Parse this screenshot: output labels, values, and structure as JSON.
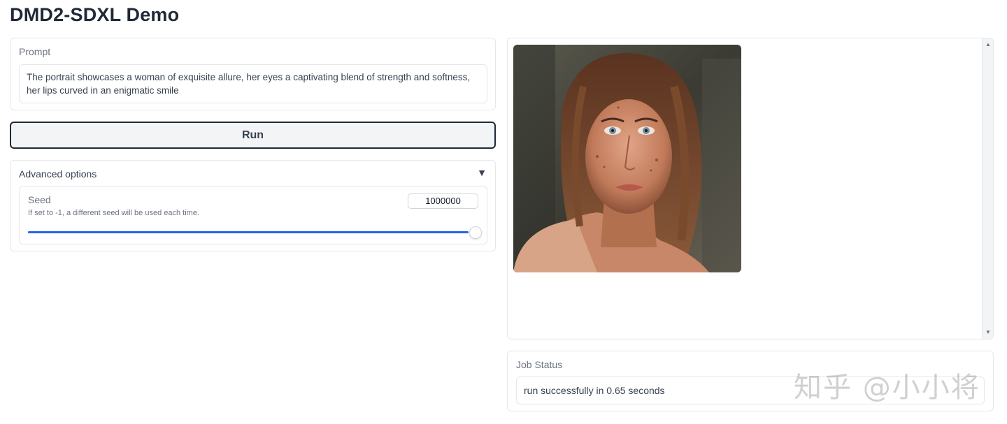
{
  "app": {
    "title": "DMD2-SDXL Demo"
  },
  "prompt": {
    "label": "Prompt",
    "value": "The portrait showcases a woman of exquisite allure, her eyes a captivating blend of strength and softness, her lips curved in an enigmatic smile"
  },
  "run_button": {
    "label": "Run"
  },
  "advanced": {
    "label": "Advanced options",
    "arrow": "▼",
    "seed": {
      "label": "Seed",
      "info": "If set to -1, a different seed will be used each time.",
      "value": "1000000",
      "slider_fraction": 1.0
    }
  },
  "gallery": {
    "image_icon": "portrait-image",
    "scroll_up": "▲",
    "scroll_down": "▼"
  },
  "job_status": {
    "label": "Job Status",
    "value": "run successfully in 0.65 seconds"
  },
  "watermark": {
    "text": "知乎 @小小将"
  },
  "colors": {
    "accent": "#2563eb",
    "border": "#e5e7eb",
    "text": "#1f2937"
  }
}
